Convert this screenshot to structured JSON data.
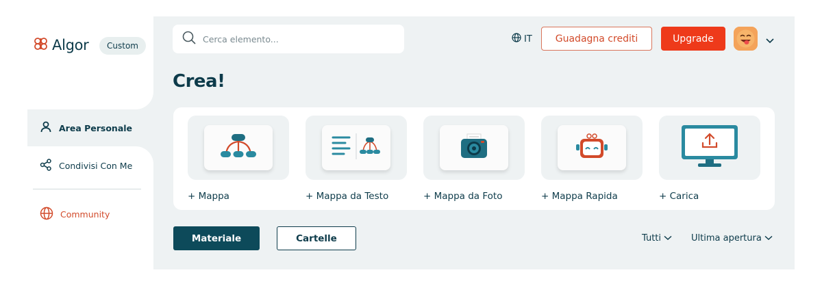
{
  "app": {
    "brand": "Algor",
    "plan_badge": "Custom"
  },
  "sidebar": {
    "items": [
      {
        "label": "Area Personale",
        "icon": "user-icon",
        "active": true
      },
      {
        "label": "Condivisi Con Me",
        "icon": "share-icon"
      },
      {
        "label": "Community",
        "icon": "globe-icon",
        "color": "#d24a2a"
      }
    ]
  },
  "header": {
    "search_placeholder": "Cerca elemento...",
    "language": "IT",
    "credits_label": "Guadagna crediti",
    "upgrade_label": "Upgrade"
  },
  "main": {
    "title": "Crea!",
    "create_cards": [
      {
        "label": "+ Mappa",
        "icon": "mindmap-icon"
      },
      {
        "label": "+ Mappa da Testo",
        "icon": "text-to-map-icon"
      },
      {
        "label": "+ Mappa da Foto",
        "icon": "camera-icon"
      },
      {
        "label": "+ Mappa Rapida",
        "icon": "robot-icon"
      },
      {
        "label": "+ Carica",
        "icon": "upload-monitor-icon"
      }
    ],
    "tabs": [
      {
        "label": "Materiale",
        "active": true
      },
      {
        "label": "Cartelle",
        "active": false
      }
    ],
    "filters": {
      "type_label": "Tutti",
      "sort_label": "Ultima apertura"
    }
  },
  "colors": {
    "primary": "#0d4a5a",
    "accent": "#ee3a1a",
    "teal": "#2a8aa0",
    "background": "#eef2f3"
  }
}
